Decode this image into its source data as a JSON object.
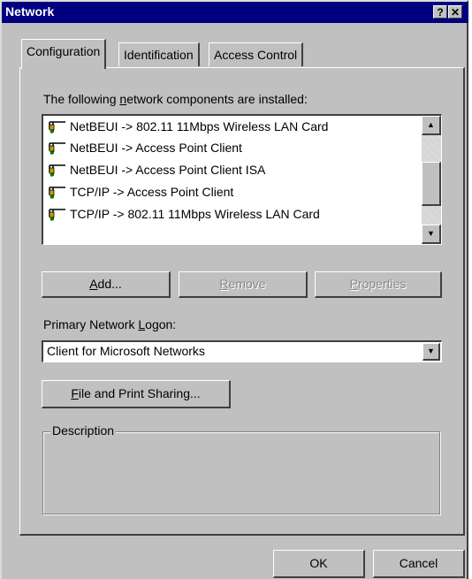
{
  "window": {
    "title": "Network",
    "help_glyph": "?",
    "close_glyph": "✕"
  },
  "tabs": [
    {
      "label": "Configuration",
      "active": true
    },
    {
      "label": "Identification",
      "active": false
    },
    {
      "label": "Access Control",
      "active": false
    }
  ],
  "components": {
    "label_prefix": "The following ",
    "label_mnemonic": "n",
    "label_suffix": "etwork components are installed:",
    "items": [
      {
        "text": "NetBEUI -> 802.11 11Mbps Wireless LAN Card",
        "icon": "network-protocol-icon"
      },
      {
        "text": "NetBEUI -> Access Point Client",
        "icon": "network-protocol-icon"
      },
      {
        "text": "NetBEUI -> Access Point Client ISA",
        "icon": "network-protocol-icon"
      },
      {
        "text": "TCP/IP -> Access Point Client",
        "icon": "network-protocol-icon"
      },
      {
        "text": "TCP/IP -> 802.11 11Mbps Wireless LAN Card",
        "icon": "network-protocol-icon"
      }
    ]
  },
  "buttons": {
    "add_mnemonic": "A",
    "add_rest": "dd...",
    "remove_mnemonic": "R",
    "remove_rest": "emove",
    "properties_mnemonic": "P",
    "properties_rest": "roperties",
    "file_print_mnemonic": "F",
    "file_print_rest": "ile and Print Sharing...",
    "ok": "OK",
    "cancel": "Cancel"
  },
  "logon": {
    "label_prefix": "Primary Network ",
    "label_mnemonic": "L",
    "label_suffix": "ogon:",
    "value": "Client for Microsoft Networks"
  },
  "description": {
    "title": "Description",
    "text": ""
  },
  "colors": {
    "titlebar": "#000080",
    "face": "#c0c0c0",
    "disabled_text": "#8a8a8a"
  }
}
